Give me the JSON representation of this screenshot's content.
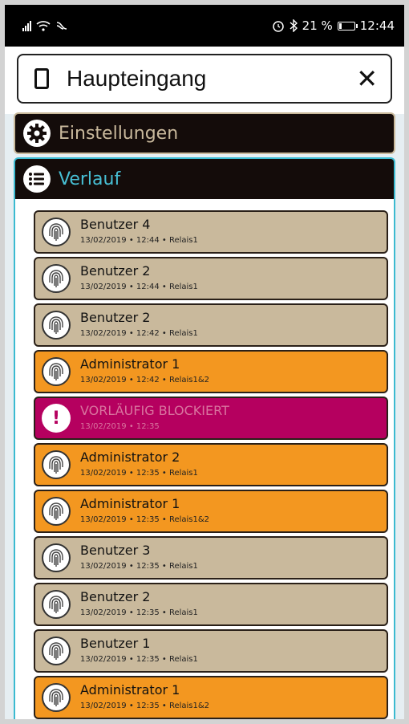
{
  "status_bar": {
    "left_icons": [
      "signal-icon",
      "wifi-icon",
      "nfc-icon"
    ],
    "right_icons": [
      "alarm-icon",
      "bluetooth-icon"
    ],
    "battery_text": "21 %",
    "battery_level": 0.21,
    "time": "12:44"
  },
  "header": {
    "title": "Haupteingang",
    "close_label": "✕"
  },
  "sections": {
    "settings_label": "Einstellungen",
    "history_label": "Verlauf"
  },
  "history": {
    "entries": [
      {
        "name": "Benutzer 4",
        "meta": "13/02/2019 • 12:44 • Relais1",
        "type": "user"
      },
      {
        "name": "Benutzer 2",
        "meta": "13/02/2019 • 12:44 • Relais1",
        "type": "user"
      },
      {
        "name": "Benutzer 2",
        "meta": "13/02/2019 • 12:42 • Relais1",
        "type": "user"
      },
      {
        "name": "Administrator 1",
        "meta": "13/02/2019 • 12:42 • Relais1&2",
        "type": "admin"
      },
      {
        "name": "VORLÄUFIG BLOCKIERT",
        "meta": "13/02/2019 • 12:35",
        "type": "blocked"
      },
      {
        "name": "Administrator 2",
        "meta": "13/02/2019 • 12:35 • Relais1",
        "type": "admin"
      },
      {
        "name": "Administrator 1",
        "meta": "13/02/2019 • 12:35 • Relais1&2",
        "type": "admin"
      },
      {
        "name": "Benutzer 3",
        "meta": "13/02/2019 • 12:35 • Relais1",
        "type": "user"
      },
      {
        "name": "Benutzer 2",
        "meta": "13/02/2019 • 12:35 • Relais1",
        "type": "user"
      },
      {
        "name": "Benutzer 1",
        "meta": "13/02/2019 • 12:35 • Relais1",
        "type": "user"
      },
      {
        "name": "Administrator 1",
        "meta": "13/02/2019 • 12:35 • Relais1&2",
        "type": "admin"
      }
    ]
  },
  "colors": {
    "user": "#c9b99c",
    "admin": "#f39720",
    "blocked": "#b5005f",
    "history_accent": "#47bfd4",
    "section_bg": "#140c0a"
  }
}
